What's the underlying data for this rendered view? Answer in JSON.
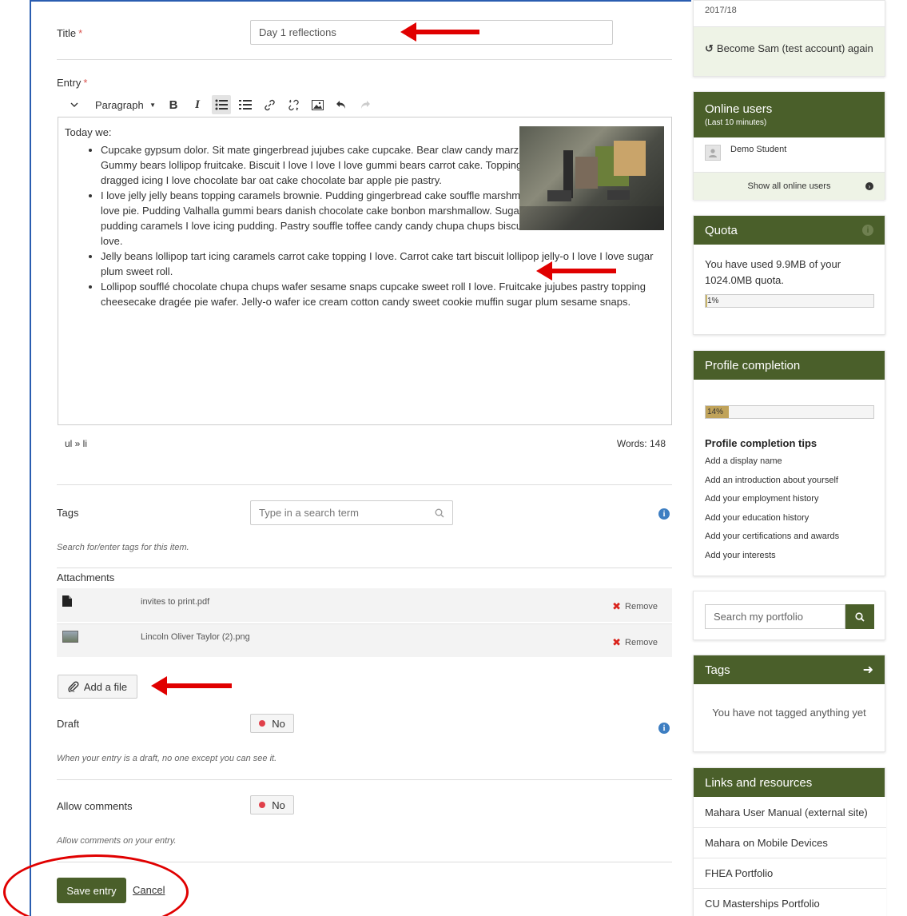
{
  "form": {
    "title_label": "Title",
    "required_mark": "*",
    "title_value": "Day 1 reflections",
    "entry_label": "Entry",
    "toolbar": {
      "chevron": "⌄",
      "format": "Paragraph",
      "bold": "B",
      "italic": "I"
    },
    "editor": {
      "intro": "Today we:",
      "items": [
        "Cupcake gypsum dolor. Sit mate gingerbread jujubes cake cupcake. Bear claw candy marzipan. Gummy bears lollipop fruitcake. Biscuit I love I love I love gummi bears carrot cake. Topping dragged icing I love chocolate bar oat cake chocolate bar apple pie pastry.",
        "I love jelly jelly beans topping caramels brownie. Pudding gingerbread cake souffle marshmallow I love pie. Pudding Valhalla gummi bears danish chocolate cake bonbon marshmallow. Sugar plum pudding caramels I love icing pudding. Pastry souffle toffee candy candy chupa chups biscuit I love.",
        "Jelly beans lollipop tart icing caramels carrot cake topping I love. Carrot cake tart biscuit lollipop jelly-o I love I love sugar plum sweet roll.",
        "Lollipop soufflé chocolate chupa chups wafer sesame snaps cupcake sweet roll I love. Fruitcake jujubes pastry topping cheesecake dragée pie wafer. Jelly-o wafer ice cream cotton candy sweet cookie muffin sugar plum sesame snaps."
      ],
      "path": "ul » li",
      "word_count": "Words: 148"
    },
    "tags_label": "Tags",
    "tags_placeholder": "Type in a search term",
    "tags_help": "Search for/enter tags for this item.",
    "attachments_label": "Attachments",
    "attachments": [
      {
        "name": "invites to print.pdf",
        "icon": "file-icon",
        "remove": "Remove"
      },
      {
        "name": "Lincoln Oliver Taylor (2).png",
        "icon": "image-thumb-icon",
        "remove": "Remove"
      }
    ],
    "add_file": "Add a file",
    "draft_label": "Draft",
    "draft_value": "No",
    "draft_help": "When your entry is a draft, no one except you can see it.",
    "comments_label": "Allow comments",
    "comments_value": "No",
    "comments_help": "Allow comments on your entry.",
    "save": "Save entry",
    "cancel": "Cancel"
  },
  "sidebar": {
    "top_partial": "2017/18",
    "become_user": "Become Sam (test account) again",
    "online_users": {
      "title": "Online users",
      "subtitle": "(Last 10 minutes)",
      "user": "Demo Student",
      "show_all": "Show all online users"
    },
    "quota": {
      "title": "Quota",
      "text": "You have used 9.9MB of your 1024.0MB quota.",
      "percent_label": "1%",
      "percent": 1
    },
    "profile": {
      "title": "Profile completion",
      "percent_label": "14%",
      "percent": 14,
      "tips_title": "Profile completion tips",
      "tips": [
        "Add a display name",
        "Add an introduction about yourself",
        "Add your employment history",
        "Add your education history",
        "Add your certifications and awards",
        "Add your interests"
      ]
    },
    "search_placeholder": "Search my portfolio",
    "tags": {
      "title": "Tags",
      "empty": "You have not tagged anything yet"
    },
    "links": {
      "title": "Links and resources",
      "items": [
        "Mahara User Manual (external site)",
        "Mahara on Mobile Devices",
        "FHEA Portfolio",
        "CU Masterships Portfolio"
      ]
    }
  },
  "colors": {
    "brand": "#4a5f2a",
    "annotation": "#e00000",
    "required": "#d9534f",
    "info": "#3d7ec2"
  }
}
